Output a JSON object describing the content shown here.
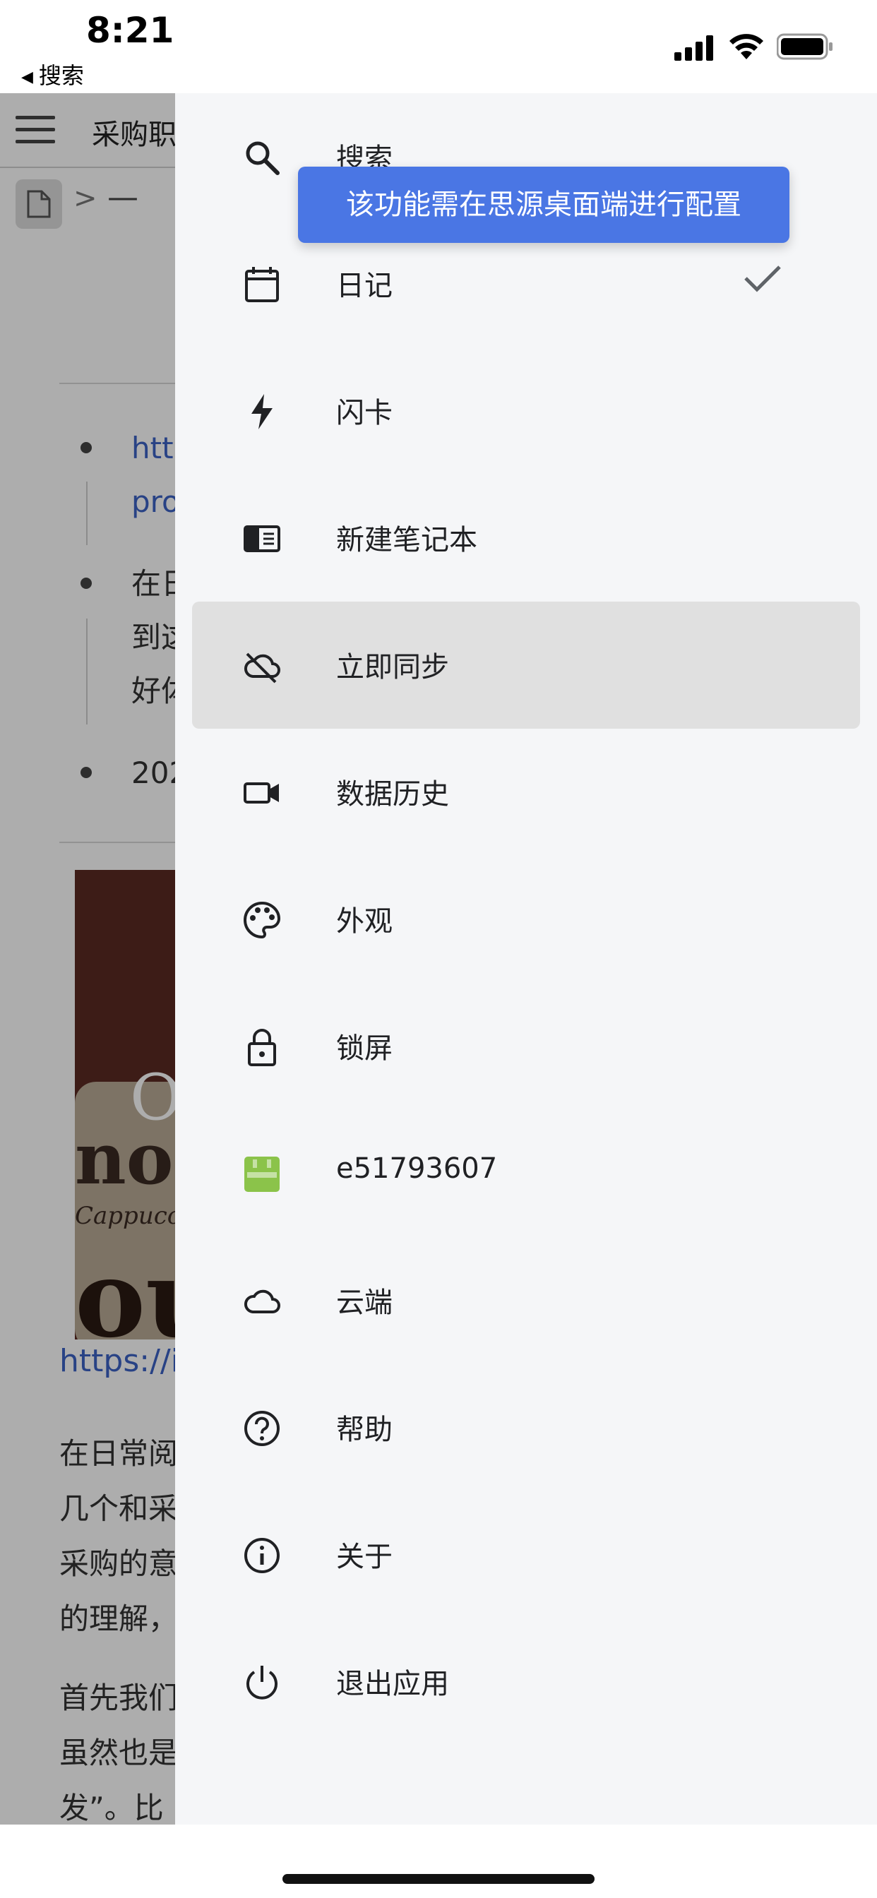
{
  "status_bar": {
    "time": "8:21",
    "back_label": "搜索",
    "back_icon": "triangle-left-icon",
    "icons": [
      "signal-icon",
      "wifi-icon",
      "battery-icon"
    ]
  },
  "document": {
    "title": "采购职",
    "breadcrumb_sep": ">",
    "breadcrumb_dash": "—",
    "bullets": [
      {
        "lines": [
          "http",
          "pro"
        ],
        "is_link": true
      },
      {
        "lines": [
          "在日",
          "到这",
          "好体"
        ],
        "is_link": false
      },
      {
        "lines": [
          "202"
        ],
        "is_link": false
      }
    ],
    "image_texts": [
      "O",
      "no",
      "Cappucc",
      "ou"
    ],
    "link_text": "https://i",
    "paragraph1": [
      "在日常阅",
      "几个和采",
      "采购的意",
      "的理解，"
    ],
    "paragraph2": [
      "首先我们",
      "虽然也是",
      "发”。比"
    ]
  },
  "menu": {
    "items": [
      {
        "key": "search",
        "label": "搜索",
        "icon": "search-icon"
      },
      {
        "key": "daily-note",
        "label": "日记",
        "icon": "calendar-icon",
        "checked": true
      },
      {
        "key": "flashcard",
        "label": "闪卡",
        "icon": "lightning-icon"
      },
      {
        "key": "new-notebook",
        "label": "新建笔记本",
        "icon": "notebook-icon"
      },
      {
        "key": "sync-now",
        "label": "立即同步",
        "icon": "cloud-off-icon",
        "active": true
      },
      {
        "key": "data-history",
        "label": "数据历史",
        "icon": "video-camera-icon"
      },
      {
        "key": "appearance",
        "label": "外观",
        "icon": "palette-icon"
      },
      {
        "key": "lock-screen",
        "label": "锁屏",
        "icon": "lock-icon"
      },
      {
        "key": "account",
        "label": "e51793607",
        "icon": "avatar-icon"
      },
      {
        "key": "cloud",
        "label": "云端",
        "icon": "cloud-icon"
      },
      {
        "key": "help",
        "label": "帮助",
        "icon": "help-circle-icon"
      },
      {
        "key": "about",
        "label": "关于",
        "icon": "info-icon"
      },
      {
        "key": "quit-app",
        "label": "退出应用",
        "icon": "power-icon"
      }
    ],
    "check_icon": "checkmark-icon"
  },
  "tooltip": {
    "text": "该功能需在思源桌面端进行配置"
  },
  "colors": {
    "accent": "#4a76e4",
    "link": "#3b62c4",
    "menu_bg": "#f5f6f8",
    "active_bg": "#e0e0e0",
    "avatar_green": "#8bc34a"
  }
}
